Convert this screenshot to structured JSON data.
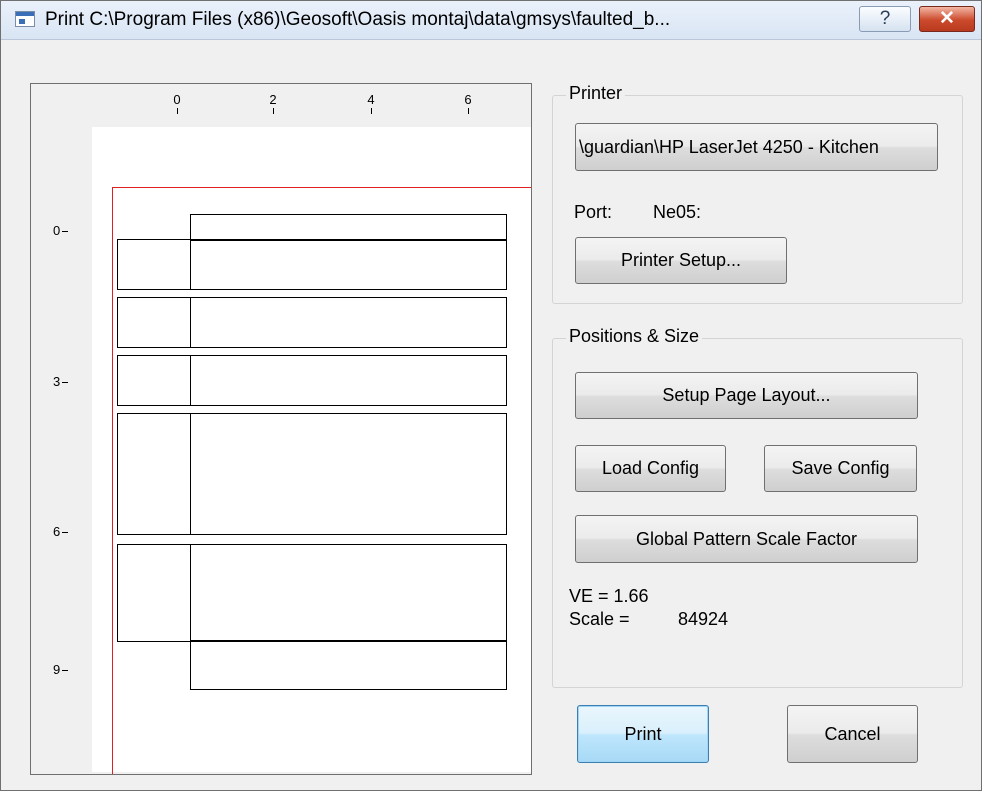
{
  "window": {
    "title": "Print C:\\Program Files (x86)\\Geosoft\\Oasis montaj\\data\\gmsys\\faulted_b...",
    "help_button": "?",
    "close_button": "✕"
  },
  "preview": {
    "x_ticks": [
      "0",
      "2",
      "4",
      "6"
    ],
    "y_ticks": [
      "0",
      "3",
      "6",
      "9"
    ]
  },
  "printer_group": {
    "label": "Printer",
    "printer_name": "\\guardian\\HP LaserJet 4250 - Kitchen",
    "port_label": "Port:",
    "port_value": "Ne05:",
    "setup_button": "Printer Setup..."
  },
  "positions_group": {
    "label": "Positions & Size",
    "setup_layout_button": "Setup Page Layout...",
    "load_config_button": "Load Config",
    "save_config_button": "Save Config",
    "pattern_scale_button": "Global Pattern Scale Factor",
    "ve_label": "VE = 1.66",
    "scale_label": "Scale =",
    "scale_value": "84924"
  },
  "footer": {
    "print_button": "Print",
    "cancel_button": "Cancel"
  },
  "colors": {
    "margin_border": "#e02020",
    "default_button_border": "#3c7fb1"
  }
}
